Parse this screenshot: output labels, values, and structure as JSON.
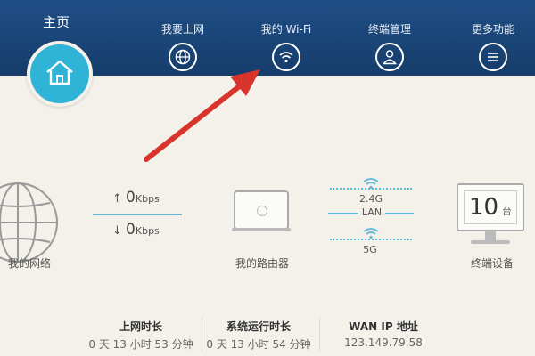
{
  "nav": {
    "home_label": "主页",
    "items": [
      {
        "label": "我要上网",
        "icon": "globe-icon"
      },
      {
        "label": "我的 Wi-Fi",
        "icon": "wifi-icon"
      },
      {
        "label": "终端管理",
        "icon": "user-icon"
      },
      {
        "label": "更多功能",
        "icon": "menu-icon"
      }
    ]
  },
  "network": {
    "upload_value": "0",
    "download_value": "0",
    "speed_unit": "Kbps",
    "label": "我的网络"
  },
  "router": {
    "label": "我的路由器"
  },
  "bands": {
    "band_24": "2.4G",
    "lan": "LAN",
    "band_5": "5G"
  },
  "devices": {
    "count": "10",
    "unit": "台",
    "label": "终端设备"
  },
  "stats": [
    {
      "title": "上网时长",
      "value": "0 天 13 小时 53 分钟"
    },
    {
      "title": "系统运行时长",
      "value": "0 天 13 小时 54 分钟"
    },
    {
      "title": "WAN IP 地址",
      "value": "123.149.79.58"
    }
  ],
  "colors": {
    "header": "#1f4e85",
    "accent": "#2fb3d6",
    "line": "#57b9dc",
    "arrow": "#d9342b"
  }
}
